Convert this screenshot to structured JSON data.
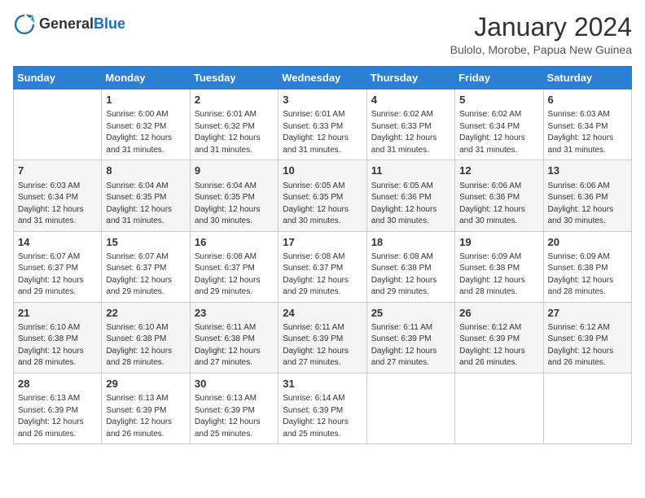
{
  "logo": {
    "general": "General",
    "blue": "Blue"
  },
  "header": {
    "month_year": "January 2024",
    "location": "Bulolo, Morobe, Papua New Guinea"
  },
  "days_of_week": [
    "Sunday",
    "Monday",
    "Tuesday",
    "Wednesday",
    "Thursday",
    "Friday",
    "Saturday"
  ],
  "weeks": [
    [
      {
        "day": "",
        "sunrise": "",
        "sunset": "",
        "daylight": ""
      },
      {
        "day": "1",
        "sunrise": "Sunrise: 6:00 AM",
        "sunset": "Sunset: 6:32 PM",
        "daylight": "Daylight: 12 hours and 31 minutes."
      },
      {
        "day": "2",
        "sunrise": "Sunrise: 6:01 AM",
        "sunset": "Sunset: 6:32 PM",
        "daylight": "Daylight: 12 hours and 31 minutes."
      },
      {
        "day": "3",
        "sunrise": "Sunrise: 6:01 AM",
        "sunset": "Sunset: 6:33 PM",
        "daylight": "Daylight: 12 hours and 31 minutes."
      },
      {
        "day": "4",
        "sunrise": "Sunrise: 6:02 AM",
        "sunset": "Sunset: 6:33 PM",
        "daylight": "Daylight: 12 hours and 31 minutes."
      },
      {
        "day": "5",
        "sunrise": "Sunrise: 6:02 AM",
        "sunset": "Sunset: 6:34 PM",
        "daylight": "Daylight: 12 hours and 31 minutes."
      },
      {
        "day": "6",
        "sunrise": "Sunrise: 6:03 AM",
        "sunset": "Sunset: 6:34 PM",
        "daylight": "Daylight: 12 hours and 31 minutes."
      }
    ],
    [
      {
        "day": "7",
        "sunrise": "Sunrise: 6:03 AM",
        "sunset": "Sunset: 6:34 PM",
        "daylight": "Daylight: 12 hours and 31 minutes."
      },
      {
        "day": "8",
        "sunrise": "Sunrise: 6:04 AM",
        "sunset": "Sunset: 6:35 PM",
        "daylight": "Daylight: 12 hours and 31 minutes."
      },
      {
        "day": "9",
        "sunrise": "Sunrise: 6:04 AM",
        "sunset": "Sunset: 6:35 PM",
        "daylight": "Daylight: 12 hours and 30 minutes."
      },
      {
        "day": "10",
        "sunrise": "Sunrise: 6:05 AM",
        "sunset": "Sunset: 6:35 PM",
        "daylight": "Daylight: 12 hours and 30 minutes."
      },
      {
        "day": "11",
        "sunrise": "Sunrise: 6:05 AM",
        "sunset": "Sunset: 6:36 PM",
        "daylight": "Daylight: 12 hours and 30 minutes."
      },
      {
        "day": "12",
        "sunrise": "Sunrise: 6:06 AM",
        "sunset": "Sunset: 6:36 PM",
        "daylight": "Daylight: 12 hours and 30 minutes."
      },
      {
        "day": "13",
        "sunrise": "Sunrise: 6:06 AM",
        "sunset": "Sunset: 6:36 PM",
        "daylight": "Daylight: 12 hours and 30 minutes."
      }
    ],
    [
      {
        "day": "14",
        "sunrise": "Sunrise: 6:07 AM",
        "sunset": "Sunset: 6:37 PM",
        "daylight": "Daylight: 12 hours and 29 minutes."
      },
      {
        "day": "15",
        "sunrise": "Sunrise: 6:07 AM",
        "sunset": "Sunset: 6:37 PM",
        "daylight": "Daylight: 12 hours and 29 minutes."
      },
      {
        "day": "16",
        "sunrise": "Sunrise: 6:08 AM",
        "sunset": "Sunset: 6:37 PM",
        "daylight": "Daylight: 12 hours and 29 minutes."
      },
      {
        "day": "17",
        "sunrise": "Sunrise: 6:08 AM",
        "sunset": "Sunset: 6:37 PM",
        "daylight": "Daylight: 12 hours and 29 minutes."
      },
      {
        "day": "18",
        "sunrise": "Sunrise: 6:08 AM",
        "sunset": "Sunset: 6:38 PM",
        "daylight": "Daylight: 12 hours and 29 minutes."
      },
      {
        "day": "19",
        "sunrise": "Sunrise: 6:09 AM",
        "sunset": "Sunset: 6:38 PM",
        "daylight": "Daylight: 12 hours and 28 minutes."
      },
      {
        "day": "20",
        "sunrise": "Sunrise: 6:09 AM",
        "sunset": "Sunset: 6:38 PM",
        "daylight": "Daylight: 12 hours and 28 minutes."
      }
    ],
    [
      {
        "day": "21",
        "sunrise": "Sunrise: 6:10 AM",
        "sunset": "Sunset: 6:38 PM",
        "daylight": "Daylight: 12 hours and 28 minutes."
      },
      {
        "day": "22",
        "sunrise": "Sunrise: 6:10 AM",
        "sunset": "Sunset: 6:38 PM",
        "daylight": "Daylight: 12 hours and 28 minutes."
      },
      {
        "day": "23",
        "sunrise": "Sunrise: 6:11 AM",
        "sunset": "Sunset: 6:38 PM",
        "daylight": "Daylight: 12 hours and 27 minutes."
      },
      {
        "day": "24",
        "sunrise": "Sunrise: 6:11 AM",
        "sunset": "Sunset: 6:39 PM",
        "daylight": "Daylight: 12 hours and 27 minutes."
      },
      {
        "day": "25",
        "sunrise": "Sunrise: 6:11 AM",
        "sunset": "Sunset: 6:39 PM",
        "daylight": "Daylight: 12 hours and 27 minutes."
      },
      {
        "day": "26",
        "sunrise": "Sunrise: 6:12 AM",
        "sunset": "Sunset: 6:39 PM",
        "daylight": "Daylight: 12 hours and 26 minutes."
      },
      {
        "day": "27",
        "sunrise": "Sunrise: 6:12 AM",
        "sunset": "Sunset: 6:39 PM",
        "daylight": "Daylight: 12 hours and 26 minutes."
      }
    ],
    [
      {
        "day": "28",
        "sunrise": "Sunrise: 6:13 AM",
        "sunset": "Sunset: 6:39 PM",
        "daylight": "Daylight: 12 hours and 26 minutes."
      },
      {
        "day": "29",
        "sunrise": "Sunrise: 6:13 AM",
        "sunset": "Sunset: 6:39 PM",
        "daylight": "Daylight: 12 hours and 26 minutes."
      },
      {
        "day": "30",
        "sunrise": "Sunrise: 6:13 AM",
        "sunset": "Sunset: 6:39 PM",
        "daylight": "Daylight: 12 hours and 25 minutes."
      },
      {
        "day": "31",
        "sunrise": "Sunrise: 6:14 AM",
        "sunset": "Sunset: 6:39 PM",
        "daylight": "Daylight: 12 hours and 25 minutes."
      },
      {
        "day": "",
        "sunrise": "",
        "sunset": "",
        "daylight": ""
      },
      {
        "day": "",
        "sunrise": "",
        "sunset": "",
        "daylight": ""
      },
      {
        "day": "",
        "sunrise": "",
        "sunset": "",
        "daylight": ""
      }
    ]
  ]
}
